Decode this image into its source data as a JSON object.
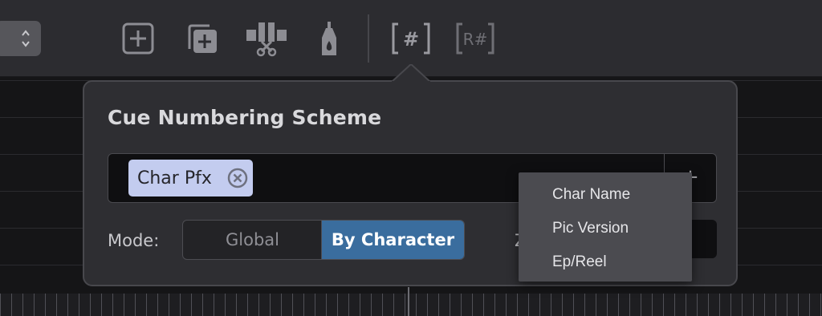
{
  "toolbar": {
    "icons": [
      {
        "name": "add-cue-icon"
      },
      {
        "name": "duplicate-cue-icon"
      },
      {
        "name": "split-cue-icon"
      },
      {
        "name": "glue-icon"
      },
      {
        "name": "cue-numbering-icon",
        "text": "[#]"
      },
      {
        "name": "renumber-icon",
        "text": "[R#]"
      }
    ]
  },
  "popover": {
    "title": "Cue Numbering Scheme",
    "tokens": [
      {
        "label": "Char Pfx"
      }
    ],
    "add_label": "+",
    "mode": {
      "label": "Mode:",
      "options": [
        "Global",
        "By Character"
      ],
      "selected": "By Character"
    },
    "partial_label": "Z"
  },
  "dropdown": {
    "items": [
      "Char Name",
      "Pic Version",
      "Ep/Reel"
    ]
  },
  "colors": {
    "accent": "#3a6d9e",
    "token_bg": "#c3ccef",
    "popover_bg": "#2e2e32"
  }
}
